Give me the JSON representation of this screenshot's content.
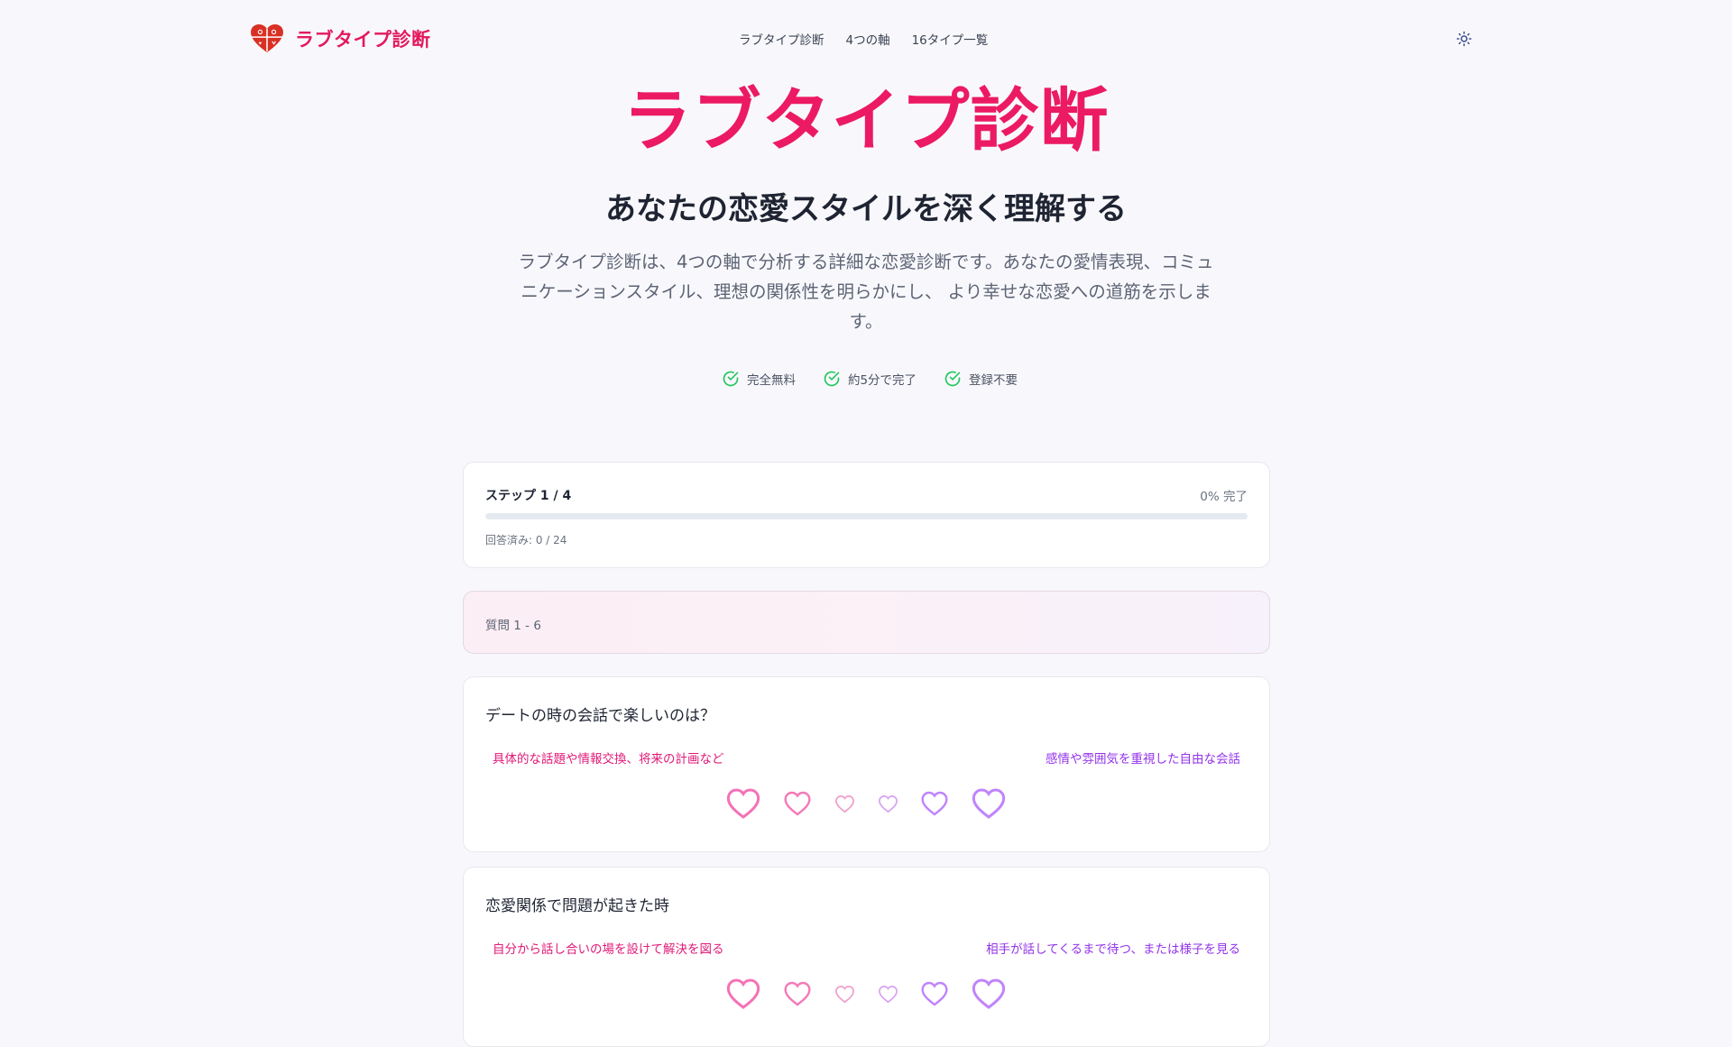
{
  "header": {
    "logo_text": "ラブタイプ診断",
    "nav": [
      "ラブタイプ診断",
      "4つの軸",
      "16タイプ一覧"
    ]
  },
  "hero": {
    "title": "ラブタイプ診断",
    "subtitle": "あなたの恋愛スタイルを深く理解する",
    "description": "ラブタイプ診断は、4つの軸で分析する詳細な恋愛診断です。あなたの愛情表現、コミュニケーションスタイル、理想の関係性を明らかにし、 より幸せな恋愛への道筋を示します。",
    "features": [
      "完全無料",
      "約5分で完了",
      "登録不要"
    ]
  },
  "progress": {
    "step": "ステップ 1 / 4",
    "percent_text": "0% 完了",
    "percent": 0,
    "answered": "回答済み: 0 / 24"
  },
  "section": {
    "label": "質問 1 - 6"
  },
  "questions": [
    {
      "text": "デートの時の会話で楽しいのは？",
      "left_option": "具体的な話題や情報交換、将来の計画など",
      "right_option": "感情や雰囲気を重視した自由な会話"
    },
    {
      "text": "恋愛関係で問題が起きた時",
      "left_option": "自分から話し合いの場を設けて解決を図る",
      "right_option": "相手が話してくるまで待つ、または様子を見る"
    }
  ],
  "colors": {
    "brand": "#ec1a62",
    "left_option": "#e01a78",
    "right_option": "#9333ea",
    "check": "#22c55e"
  },
  "icons": [
    "heart-logo-icon",
    "sun-icon",
    "check-circle-icon",
    "heart-icon"
  ]
}
